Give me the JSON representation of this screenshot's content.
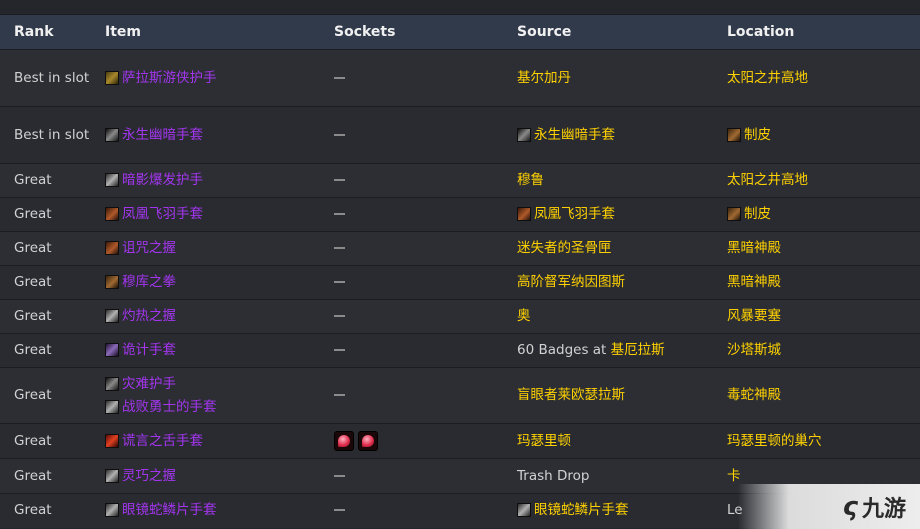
{
  "headers": {
    "rank": "Rank",
    "item": "Item",
    "sockets": "Sockets",
    "source": "Source",
    "location": "Location"
  },
  "rows": [
    {
      "rank": "Best in slot",
      "item": "萨拉斯游侠护手",
      "item_icon": "gloves-icon",
      "source": "基尔加丹",
      "location": "太阳之井高地"
    },
    {
      "rank": "Best in slot",
      "item": "永生幽暗手套",
      "item_icon": "gloves-icon",
      "source": "永生幽暗手套",
      "source_icon": "gloves-icon",
      "location": "制皮",
      "location_icon": "leather-icon"
    },
    {
      "rank": "Great",
      "item": "暗影爆发护手",
      "item_icon": "gloves-icon",
      "source": "穆鲁",
      "location": "太阳之井高地"
    },
    {
      "rank": "Great",
      "item": "凤凰飞羽手套",
      "item_icon": "gloves-icon",
      "source": "凤凰飞羽手套",
      "source_icon": "gloves-icon",
      "location": "制皮",
      "location_icon": "leather-icon"
    },
    {
      "rank": "Great",
      "item": "诅咒之握",
      "item_icon": "gloves-icon",
      "source": "迷失者的圣骨匣",
      "location": "黑暗神殿"
    },
    {
      "rank": "Great",
      "item": "穆库之拳",
      "item_icon": "gloves-icon",
      "source": "高阶督军纳因图斯",
      "location": "黑暗神殿"
    },
    {
      "rank": "Great",
      "item": "灼热之握",
      "item_icon": "gloves-icon",
      "source": "奥",
      "location": "风暴要塞"
    },
    {
      "rank": "Great",
      "item": "诡计手套",
      "item_icon": "gloves-icon",
      "source_prefix": "60 Badges at ",
      "source": "基厄拉斯",
      "location": "沙塔斯城"
    },
    {
      "rank": "Great",
      "item": "灾难护手",
      "item2": "战败勇士的手套",
      "item_icon": "gloves-icon",
      "source": "盲眼者莱欧瑟拉斯",
      "location": "毒蛇神殿"
    },
    {
      "rank": "Great",
      "item": "谎言之舌手套",
      "item_icon": "gloves-icon",
      "sockets": [
        "red-gem-socket",
        "red-gem-socket"
      ],
      "source": "玛瑟里顿",
      "location": "玛瑟里顿的巢穴"
    },
    {
      "rank": "Great",
      "item": "灵巧之握",
      "item_icon": "gloves-icon",
      "source": "Trash Drop",
      "location": "卡"
    },
    {
      "rank": "Great",
      "item": "眼镜蛇鳞片手套",
      "item_icon": "gloves-icon",
      "source": "眼镜蛇鳞片手套",
      "source_icon": "gloves-icon",
      "location": "Le"
    }
  ],
  "watermark": {
    "mark": "ς",
    "text": "九游"
  }
}
